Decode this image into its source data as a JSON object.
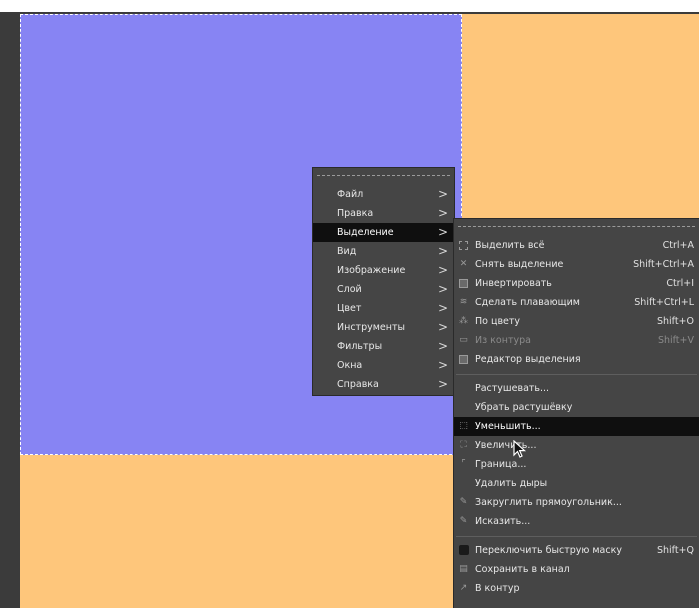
{
  "main_menu": {
    "items": [
      {
        "label": "Файл"
      },
      {
        "label": "Правка"
      },
      {
        "label": "Выделение",
        "active": true
      },
      {
        "label": "Вид"
      },
      {
        "label": "Изображение"
      },
      {
        "label": "Слой"
      },
      {
        "label": "Цвет"
      },
      {
        "label": "Инструменты"
      },
      {
        "label": "Фильтры"
      },
      {
        "label": "Окна"
      },
      {
        "label": "Справка"
      }
    ],
    "arrow_glyph": ">"
  },
  "select_menu": {
    "group1": [
      {
        "label": "Выделить всё",
        "shortcut": "Ctrl+A",
        "icon": "select-all-icon"
      },
      {
        "label": "Снять выделение",
        "shortcut": "Shift+Ctrl+A",
        "icon": "select-none-icon"
      },
      {
        "label": "Инвертировать",
        "shortcut": "Ctrl+I",
        "icon": "invert-icon"
      },
      {
        "label": "Сделать плавающим",
        "shortcut": "Shift+Ctrl+L",
        "icon": "float-icon"
      },
      {
        "label": "По цвету",
        "shortcut": "Shift+O",
        "icon": "by-color-icon"
      },
      {
        "label": "Из контура",
        "shortcut": "Shift+V",
        "icon": "from-path-icon",
        "disabled": true
      },
      {
        "label": "Редактор выделения",
        "shortcut": "",
        "icon": "selection-editor-icon"
      }
    ],
    "group2": [
      {
        "label": "Растушевать...",
        "shortcut": "",
        "icon": ""
      },
      {
        "label": "Убрать растушёвку",
        "shortcut": "",
        "icon": ""
      },
      {
        "label": "Уменьшить...",
        "shortcut": "",
        "icon": "shrink-icon",
        "active": true
      },
      {
        "label": "Увеличить...",
        "shortcut": "",
        "icon": "grow-icon"
      },
      {
        "label": "Граница...",
        "shortcut": "",
        "icon": "border-icon"
      },
      {
        "label": "Удалить дыры",
        "shortcut": "",
        "icon": ""
      },
      {
        "label": "Закруглить прямоугольник...",
        "shortcut": "",
        "icon": "rounded-rect-icon"
      },
      {
        "label": "Исказить...",
        "shortcut": "",
        "icon": "distort-icon"
      }
    ],
    "group3": [
      {
        "label": "Переключить быструю маску",
        "shortcut": "Shift+Q",
        "icon": "quick-mask-icon"
      },
      {
        "label": "Сохранить в канал",
        "shortcut": "",
        "icon": "save-channel-icon"
      },
      {
        "label": "В контур",
        "shortcut": "",
        "icon": "to-path-icon"
      }
    ]
  },
  "colors": {
    "image_orange": "#fec67b",
    "image_blue": "#8784f3",
    "menu_bg": "#454545",
    "menu_active": "#0f0f0f"
  }
}
